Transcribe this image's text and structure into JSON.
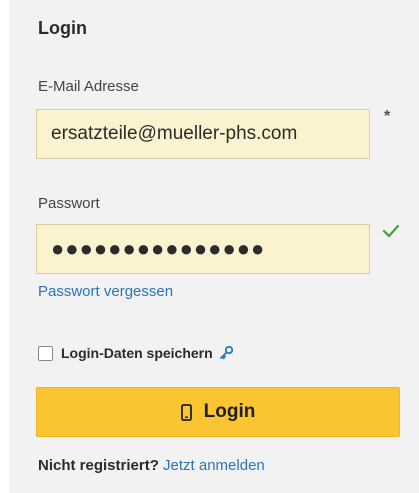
{
  "form": {
    "title": "Login",
    "email": {
      "label": "E-Mail Adresse",
      "value": "ersatzteile@mueller-phs.com",
      "required_marker": "*"
    },
    "password": {
      "label": "Passwort",
      "masked_value": "●●●●●●●●●●●●●●●",
      "valid_icon": "checkmark-icon"
    },
    "forgot_link": "Passwort vergessen",
    "remember": {
      "label": "Login-Daten speichern",
      "checked": false,
      "icon": "key-icon"
    },
    "login_button": {
      "label": "Login",
      "icon": "mobile-phone-icon"
    },
    "register": {
      "text": "Nicht registriert?",
      "link": "Jetzt anmelden"
    }
  },
  "colors": {
    "panel_bg": "#f2f2f2",
    "input_bg": "#fbf3cf",
    "accent_button": "#fbc531",
    "link": "#2b74b8",
    "valid_check": "#3fa535"
  }
}
